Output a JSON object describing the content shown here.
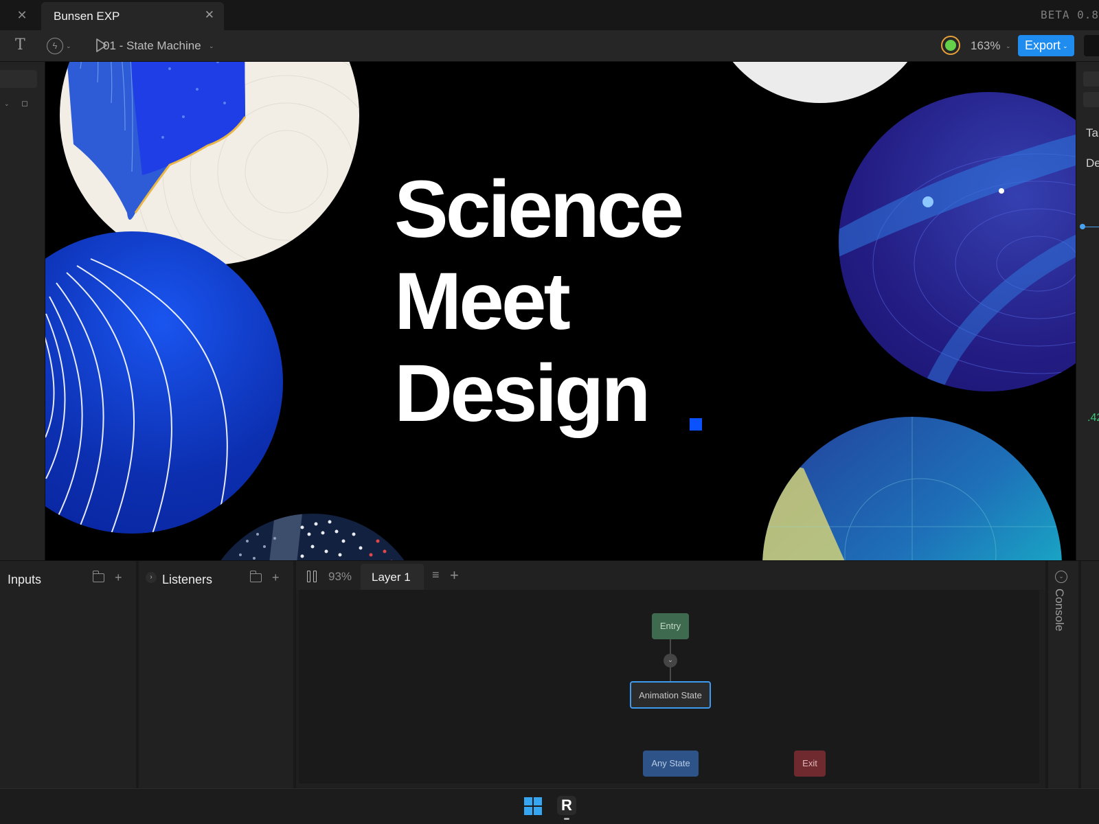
{
  "window": {
    "doc_tab_title": "Bunsen EXP",
    "version_label": "BETA 0.8"
  },
  "toolbar": {
    "state_machine_name": "01 - State Machine",
    "zoom": "163%",
    "export_label": "Export"
  },
  "artboard": {
    "headline": [
      "Science",
      "Meet",
      "Design"
    ],
    "accent_color": "#0b52ff"
  },
  "right_panel": {
    "label_ta": "Ta",
    "label_de": "De",
    "value": ".42"
  },
  "panels": {
    "inputs_title": "Inputs",
    "listeners_title": "Listeners",
    "graph_zoom": "93%",
    "layer_tab": "Layer 1",
    "console_label": "Console"
  },
  "graph": {
    "entry": "Entry",
    "animation_state": "Animation State",
    "any_state": "Any State",
    "exit": "Exit"
  },
  "icons": {
    "close": "✕",
    "text_tool": "T",
    "bolt": "ϟ",
    "caret": "⌄",
    "plus": "+",
    "menu": "≡",
    "chevron_right": "›",
    "chevron_down": "⌄",
    "rive": "R"
  },
  "colors": {
    "export_button": "#1f8cf0",
    "entry_node": "#3e6b50",
    "any_state_node": "#2d5389",
    "exit_node": "#6e2a2f",
    "selection_outline": "#3d9bf0"
  }
}
